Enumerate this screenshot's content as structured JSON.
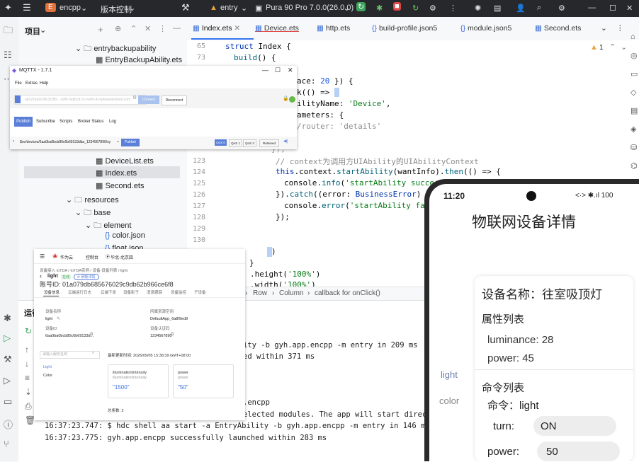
{
  "topbar": {
    "project_badge": "E",
    "project": "encpp",
    "vcs": "版本控制",
    "module": "entry",
    "device": "Pura 90 Pro 7.0.0(26.0.0)"
  },
  "project_panel": {
    "title": "项目",
    "items": [
      "entrybackupability",
      "EntryBackupAbility.ets",
      "DeviceList.ets",
      "Index.ets",
      "Second.ets",
      "resources",
      "base",
      "element",
      "color.json",
      "float.json"
    ]
  },
  "tabs": [
    "Index.ets",
    "Device.ets",
    "http.ets",
    "build-profile.json5",
    "module.json5",
    "Second.ets"
  ],
  "editor": {
    "warning_count": "1",
    "line_numbers": [
      "65",
      "73",
      "123",
      "124",
      "125",
      "126",
      "127",
      "128",
      "129",
      "130"
    ],
    "lines": {
      "l1_a": "struct ",
      "l1_b": "Index",
      "l1_c": " {",
      "l2_a": "build",
      "l2_b": "() {",
      "l3_a": "ace: ",
      "l3_b": "20",
      "l3_c": " }) {",
      "l4": "k(() => ",
      "l5_a": "ilityName: ",
      "l5_b": "'Device'",
      "l5_c": ",",
      "l6": "ameters: {",
      "l7": "/router: 'details'",
      "l8": "});",
      "l9": "// context为调用方UIAbility的UIAbilityContext",
      "l10_a": "this",
      "l10_b": ".context.",
      "l10_c": "startAbility",
      "l10_d": "(wantInfo).",
      "l10_e": "then",
      "l10_f": "(() => {",
      "l11_a": "console.",
      "l11_b": "info",
      "l11_c": "(",
      "l11_d": "'startAbility succes",
      "l12_a": "}).",
      "l12_b": "catch",
      "l12_c": "((error: ",
      "l12_d": "BusinessError",
      "l12_e": ") => {",
      "l13_a": "console.",
      "l13_b": "error",
      "l13_c": "(",
      "l13_d": "'startAbility failed",
      "l14": "});",
      "l15": ")",
      "l16": "}",
      "l17_a": ".height(",
      "l17_b": "'100%'",
      "l17_c": ")",
      "l18_a": ".width(",
      "l18_b": "'100%'",
      "l18_c": ")"
    }
  },
  "breadcrumb": [
    "Row",
    "Column",
    "callback for onClick()"
  ],
  "run_panel": {
    "title": "运行",
    "logs": [
      "ity -b gyh.app.encpp -m entry in 209 ms",
      "ed within 371 ms",
      ".encpp",
      "elected modules. The app will start directl",
      "16:37:23.747: $ hdc shell aa start -a EntryAbility -b gyh.app.encpp -m entry in 146 ms",
      "16:37:23.775: gyh.app.encpp successfully launched within 283 ms"
    ]
  },
  "mqttx": {
    "title": "MQTTX - 1.7.1",
    "menu": [
      "File",
      "Extras",
      "Help"
    ],
    "url": "a0122ea0c05c3c0f0...-a3f4.mqtt.iot.cn-north-4.myhuaweicloud.com",
    "connect": "Connect",
    "disconnect": "Disconnect",
    "tabs": [
      "Publish",
      "Subscribe",
      "Scripts",
      "Broker Status",
      "Log"
    ],
    "topic": "$oc/devices/6aa0ba0bcb80c6b69133dba_1234567890/sy",
    "publish_btn": "Publish",
    "qos": [
      "QoS 0",
      "QoS 1",
      "QoS 2"
    ],
    "retain": "Retained"
  },
  "huawei_console": {
    "brand": "华为云",
    "console": "控制台",
    "region": "华北-北京四",
    "crumbs": "设备接入 IoTDA / IoTDA实例 / 设备-设备列表 / light",
    "device_name": "light",
    "status": "在线",
    "refresh": "刷新详情",
    "device_id": "账号ID: 01a079db685676029c9db62b966ce6f8",
    "tabs": [
      "设备信息",
      "云端运行日志",
      "云端下发",
      "设备影子",
      "消息跟踪",
      "设备监控",
      "子设备"
    ],
    "info_labels": [
      "设备名称",
      "所属资源空间",
      "设备ID",
      "设备认证码"
    ],
    "info_values": [
      "light",
      "DefaultApp_6a8f9ed9",
      "6aa0ba0bcb80c6b69133d...",
      "1234567890"
    ],
    "search_placeholder": "请输入服务名称",
    "services": [
      "Light",
      "Color"
    ],
    "latest": "最新更新时间: 2026/09/05 15:38:39 GMT+08:00",
    "card1_title": "illuminationIntensity",
    "card1_sub": "illuminationIntensity",
    "card1_value": "\"1500\"",
    "card2_title": "power",
    "card2_sub": "power",
    "card2_value": "\"50\"",
    "total": "总条数: 2"
  },
  "phone": {
    "time": "11:20",
    "status_icons": "<·> ✱.ıl 100",
    "title": "物联网设备详情",
    "device_name": "设备名称：往室吸顶灯",
    "attr_header": "属性列表",
    "luminance": "luminance:  28",
    "power_attr": "power:  45",
    "side_items": [
      "light",
      "color"
    ],
    "cmd_header": "命令列表",
    "cmd": "命令：light",
    "turn_label": "turn:",
    "turn_value": "ON",
    "power_label": "power:",
    "power_value": "50"
  }
}
